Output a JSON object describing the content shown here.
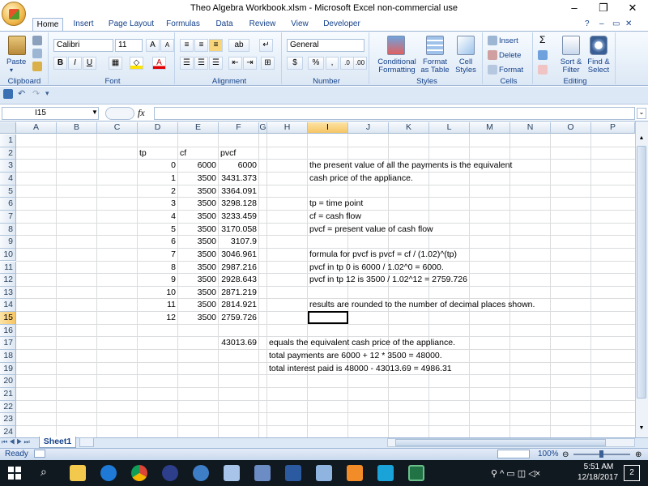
{
  "window": {
    "title": "Theo Algebra Workbook.xlsm - Microsoft Excel non-commercial use",
    "controls": [
      "–",
      "❐",
      "✕"
    ],
    "doc_controls": [
      "–",
      "▭",
      "✕"
    ]
  },
  "tabs": [
    "Home",
    "Insert",
    "Page Layout",
    "Formulas",
    "Data",
    "Review",
    "View",
    "Developer"
  ],
  "ribbon": {
    "clipboard": {
      "paste_label": "Paste",
      "group_label": "Clipboard"
    },
    "font": {
      "font_name": "Calibri",
      "font_size": "11",
      "bold": "B",
      "italic": "I",
      "underline": "U",
      "group_label": "Font"
    },
    "alignment": {
      "group_label": "Alignment"
    },
    "number": {
      "format": "General",
      "currency": "$",
      "percent": "%",
      "comma": ",",
      "group_label": "Number"
    },
    "styles": {
      "conditional": "Conditional Formatting",
      "format_table": "Format as Table",
      "cell_styles": "Cell Styles",
      "group_label": "Styles"
    },
    "cells": {
      "insert": "Insert",
      "delete": "Delete",
      "format": "Format",
      "group_label": "Cells"
    },
    "editing": {
      "sort": "Sort & Filter",
      "find": "Find & Select",
      "group_label": "Editing"
    }
  },
  "formula_bar": {
    "name_box": "I15",
    "fx": "fx",
    "formula": ""
  },
  "columns": [
    "A",
    "B",
    "C",
    "D",
    "E",
    "F",
    "G",
    "H",
    "I",
    "J",
    "K",
    "L",
    "M",
    "N",
    "O",
    "P"
  ],
  "rows": [
    "1",
    "2",
    "3",
    "4",
    "5",
    "6",
    "7",
    "8",
    "9",
    "10",
    "11",
    "12",
    "13",
    "14",
    "15",
    "16",
    "17",
    "18",
    "19",
    "20",
    "21",
    "22",
    "23",
    "24"
  ],
  "cells": {
    "D2": "tp",
    "E2": "cf",
    "F2": "pvcf",
    "D3": "0",
    "E3": "6000",
    "F3": "6000",
    "D4": "1",
    "E4": "3500",
    "F4": "3431.373",
    "D5": "2",
    "E5": "3500",
    "F5": "3364.091",
    "D6": "3",
    "E6": "3500",
    "F6": "3298.128",
    "D7": "4",
    "E7": "3500",
    "F7": "3233.459",
    "D8": "5",
    "E8": "3500",
    "F8": "3170.058",
    "D9": "6",
    "E9": "3500",
    "F9": "3107.9",
    "D10": "7",
    "E10": "3500",
    "F10": "3046.961",
    "D11": "8",
    "E11": "3500",
    "F11": "2987.216",
    "D12": "9",
    "E12": "3500",
    "F12": "2928.643",
    "D13": "10",
    "E13": "3500",
    "F13": "2871.219",
    "D14": "11",
    "E14": "3500",
    "F14": "2814.921",
    "D15": "12",
    "E15": "3500",
    "F15": "2759.726",
    "F17": "43013.69",
    "I3": "the present value of all the payments is the equivalent",
    "I4": "cash price of the appliance.",
    "I6": "tp = time point",
    "I7": "cf = cash flow",
    "I8": "pvcf = present value of cash flow",
    "I10": "formula for pvcf is pvcf = cf / (1.02)^(tp)",
    "I11": "pvcf in tp 0 is 6000 / 1.02^0 = 6000.",
    "I12": "pvcf in tp 12 is 3500 / 1.02^12 = 2759.726",
    "I14": "results are rounded to the number of decimal places shown.",
    "H17": "equals the equivalent cash price of the appliance.",
    "H18": "total payments are 6000 + 12 * 3500 = 48000.",
    "H19": "total interest paid is 48000 - 43013.69 = 4986.31"
  },
  "selected": {
    "col": "I",
    "row": "15"
  },
  "sheet_tab": "Sheet1",
  "status": {
    "ready": "Ready",
    "zoom": "100%"
  },
  "taskbar": {
    "time": "5:51 AM",
    "date": "12/18/2017",
    "notifications": "2"
  }
}
